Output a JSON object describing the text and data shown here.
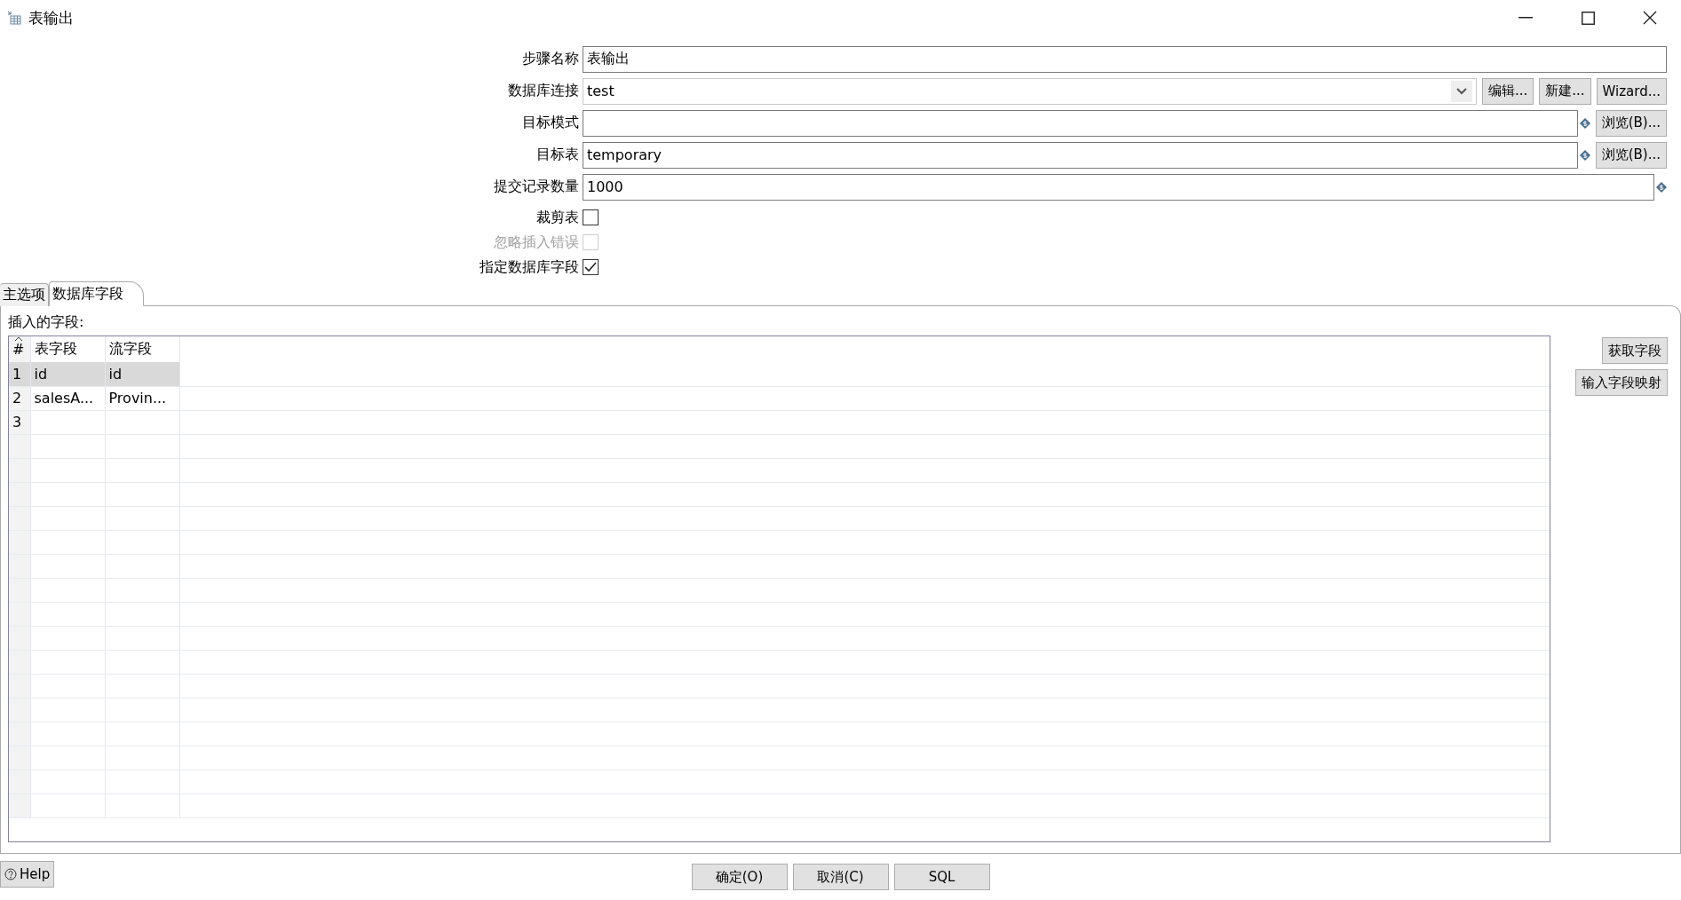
{
  "window": {
    "title": "表输出"
  },
  "fields": [
    {
      "kind": "text",
      "label": "步骤名称",
      "value": "表输出",
      "variable": false
    },
    {
      "kind": "combo",
      "label": "数据库连接",
      "value": "test",
      "variable": false,
      "buttons": [
        "编辑...",
        "新建...",
        "Wizard..."
      ]
    },
    {
      "kind": "text",
      "label": "目标模式",
      "variable": true,
      "buttons": [
        "浏览(B)..."
      ]
    },
    {
      "kind": "text",
      "label": "目标表",
      "value": "temporary",
      "variable": true,
      "buttons": [
        "浏览(B)..."
      ]
    },
    {
      "kind": "text",
      "label": "提交记录数量",
      "value": "1000",
      "variable": true
    }
  ],
  "checkboxes": [
    {
      "label": "裁剪表",
      "checked": false,
      "disabled": false
    },
    {
      "label": "忽略插入错误",
      "checked": false,
      "disabled": true
    },
    {
      "label": "指定数据库字段",
      "checked": true,
      "disabled": false
    }
  ],
  "tabs": [
    {
      "label": "主选项",
      "selected": false
    },
    {
      "label": "数据库字段",
      "selected": true
    }
  ],
  "table": {
    "label": "插入的字段:",
    "columns": [
      "#",
      "表字段",
      "流字段"
    ],
    "rows": [
      {
        "cells": [
          "1",
          "id",
          "id"
        ],
        "selected": true
      },
      {
        "cells": [
          "2",
          "salesA...",
          "Provin..."
        ],
        "selected": false
      },
      {
        "cells": [
          "3"
        ],
        "selected": false
      }
    ]
  },
  "side_buttons": [
    "获取字段",
    "输入字段映射"
  ],
  "help": "Help",
  "buttons": [
    "确定(O)",
    "取消(C)",
    "SQL"
  ]
}
